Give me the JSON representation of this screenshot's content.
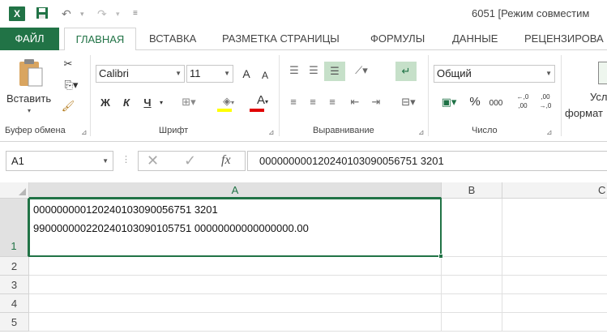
{
  "titlebar": {
    "title": "6051  [Режим совместим"
  },
  "tabs": {
    "file": "ФАЙЛ",
    "home": "ГЛАВНАЯ",
    "insert": "ВСТАВКА",
    "layout": "РАЗМЕТКА СТРАНИЦЫ",
    "formulas": "ФОРМУЛЫ",
    "data": "ДАННЫЕ",
    "review": "РЕЦЕНЗИРОВА"
  },
  "ribbon": {
    "clipboard": {
      "paste_label": "Вставить",
      "group_label": "Буфер обмена"
    },
    "font": {
      "font_name": "Calibri",
      "font_size": "11",
      "bold": "Ж",
      "italic": "К",
      "underline": "Ч",
      "grow": "A",
      "shrink": "A",
      "font_color": "A",
      "group_label": "Шрифт"
    },
    "alignment": {
      "group_label": "Выравнивание"
    },
    "number": {
      "format": "Общий",
      "percent": "%",
      "thousands": "000",
      "inc_decimal": "←,0 ,00",
      "dec_decimal": ",00 →,0",
      "group_label": "Число"
    },
    "styles": {
      "cond_label_1": "Усл",
      "cond_label_2": "формат"
    }
  },
  "formula_bar": {
    "name_box": "A1",
    "fx": "fx",
    "content": "000000000120240103090056751  3201"
  },
  "grid": {
    "columns": [
      "A",
      "B",
      "C"
    ],
    "rows": [
      "1",
      "2",
      "3",
      "4",
      "5"
    ],
    "cell_a1": {
      "line1": "000000000120240103090056751  3201",
      "line2": "990000000220240103090105751  00000000000000000.00"
    }
  },
  "colors": {
    "accent": "#217346"
  }
}
